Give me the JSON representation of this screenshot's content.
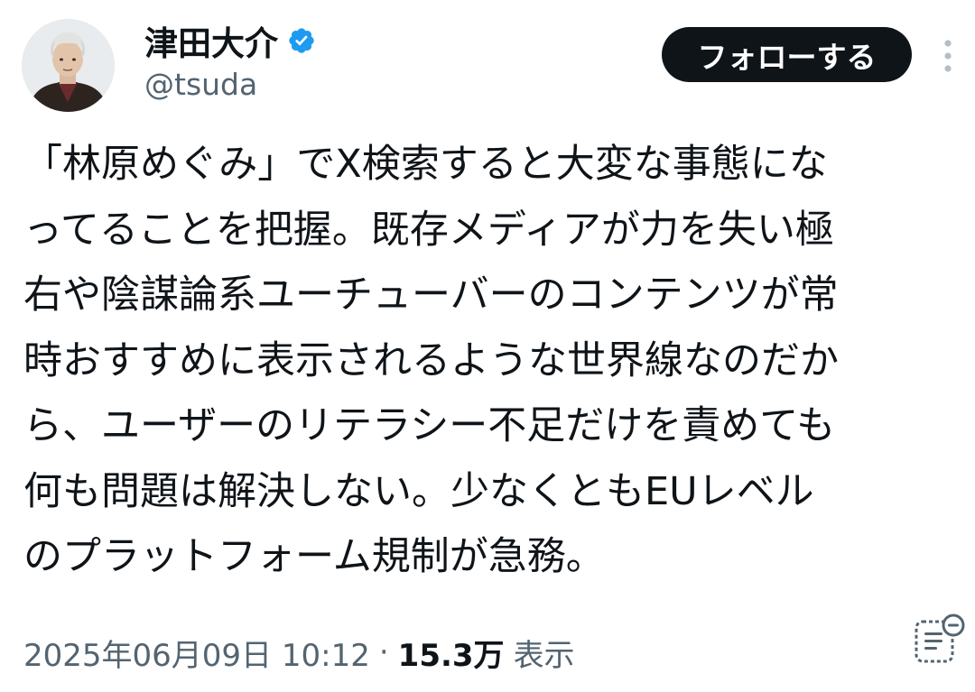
{
  "author": {
    "display_name": "津田大介",
    "handle": "@tsuda",
    "verified": true,
    "verified_color": "#1d9bf0",
    "avatar_icon": "profile-photo"
  },
  "actions": {
    "follow_label": "フォローする",
    "more_icon": "more-vertical-icon"
  },
  "tweet": {
    "lines": [
      "「林原めぐみ」でX検索すると大変な事態にな",
      "ってることを把握。既存メディアが力を失い極",
      "右や陰謀論系ユーチューバーのコンテンツが常",
      "時おすすめに表示されるような世界線なのだか",
      "ら、ユーザーのリテラシー不足だけを責めても",
      "何も問題は解決しない。少なくともEUレベル",
      "のプラットフォーム規制が急務。"
    ]
  },
  "meta": {
    "timestamp": "2025年06月09日 10:12",
    "separator": "·",
    "views": "15.3万",
    "views_label": "表示",
    "summary_icon": "grok-summary-icon"
  },
  "colors": {
    "text_primary": "#0f1419",
    "text_secondary": "#536471",
    "button_bg": "#0f1419",
    "button_text": "#ffffff"
  }
}
